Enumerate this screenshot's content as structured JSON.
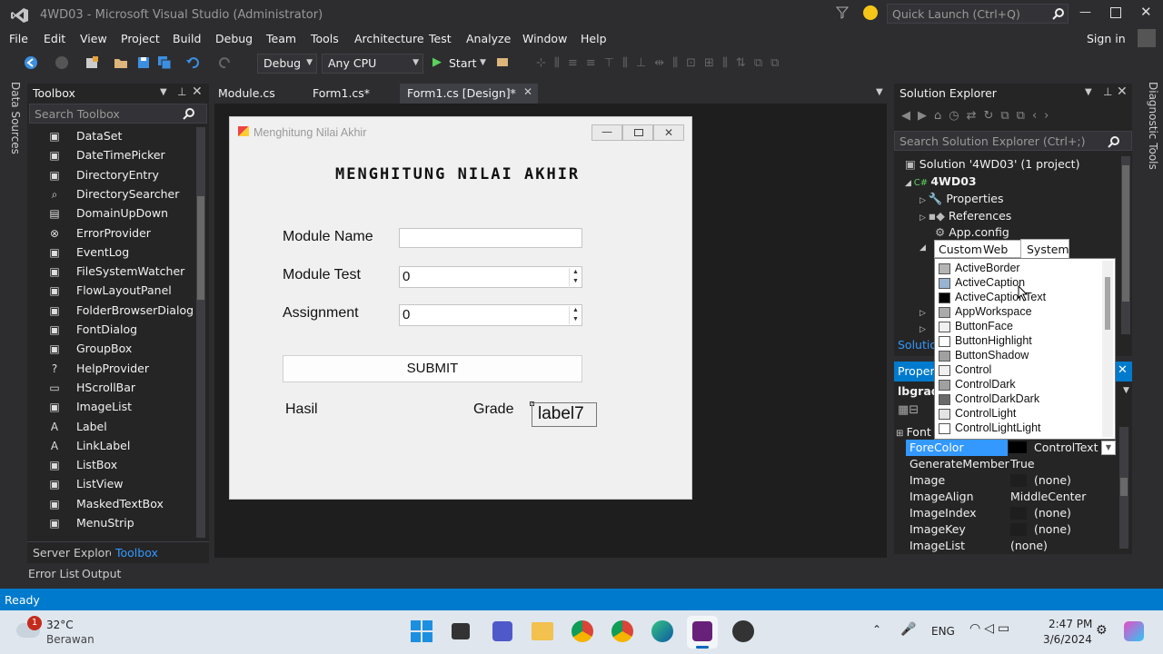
{
  "window": {
    "title": "4WD03 - Microsoft Visual Studio (Administrator)",
    "quick_launch_placeholder": "Quick Launch (Ctrl+Q)",
    "sign_in": "Sign in"
  },
  "menu": [
    "File",
    "Edit",
    "View",
    "Project",
    "Build",
    "Debug",
    "Team",
    "Tools",
    "Architecture",
    "Test",
    "Analyze",
    "Window",
    "Help"
  ],
  "toolbar": {
    "config": "Debug",
    "platform": "Any CPU",
    "start_label": "Start"
  },
  "left_strip": {
    "data_sources": "Data Sources"
  },
  "right_strip": {
    "diagnostic_tools": "Diagnostic Tools"
  },
  "toolbox": {
    "title": "Toolbox",
    "search_placeholder": "Search Toolbox",
    "items": [
      {
        "icon": "dataset-icon",
        "label": "DataSet"
      },
      {
        "icon": "datetimepicker-icon",
        "label": "DateTimePicker"
      },
      {
        "icon": "directoryentry-icon",
        "label": "DirectoryEntry"
      },
      {
        "icon": "directorysearcher-icon",
        "label": "DirectorySearcher"
      },
      {
        "icon": "domainupdown-icon",
        "label": "DomainUpDown"
      },
      {
        "icon": "errorprovider-icon",
        "label": "ErrorProvider"
      },
      {
        "icon": "eventlog-icon",
        "label": "EventLog"
      },
      {
        "icon": "filesystemwatcher-icon",
        "label": "FileSystemWatcher"
      },
      {
        "icon": "flowlayoutpanel-icon",
        "label": "FlowLayoutPanel"
      },
      {
        "icon": "folderbrowserdialog-icon",
        "label": "FolderBrowserDialog"
      },
      {
        "icon": "fontdialog-icon",
        "label": "FontDialog"
      },
      {
        "icon": "groupbox-icon",
        "label": "GroupBox"
      },
      {
        "icon": "helpprovider-icon",
        "label": "HelpProvider"
      },
      {
        "icon": "hscrollbar-icon",
        "label": "HScrollBar"
      },
      {
        "icon": "imagelist-icon",
        "label": "ImageList"
      },
      {
        "icon": "label-icon",
        "label": "Label"
      },
      {
        "icon": "linklabel-icon",
        "label": "LinkLabel"
      },
      {
        "icon": "listbox-icon",
        "label": "ListBox"
      },
      {
        "icon": "listview-icon",
        "label": "ListView"
      },
      {
        "icon": "maskedtextbox-icon",
        "label": "MaskedTextBox"
      },
      {
        "icon": "menustrip-icon",
        "label": "MenuStrip"
      }
    ],
    "bottom_tabs": [
      "Server Explorer",
      "Toolbox"
    ]
  },
  "doc_tabs": [
    "Module.cs",
    "Form1.cs*",
    "Form1.cs [Design]*"
  ],
  "form": {
    "title": "Menghitung Nilai Akhir",
    "heading": "MENGHITUNG NILAI AKHIR",
    "module_name_label": "Module Name",
    "module_name_value": "",
    "module_test_label": "Module Test",
    "module_test_value": "0",
    "assignment_label": "Assignment",
    "assignment_value": "0",
    "submit_label": "SUBMIT",
    "hasil_label": "Hasil",
    "grade_label": "Grade",
    "grade_value_label": "label7"
  },
  "solution_explorer": {
    "title": "Solution Explorer",
    "search_placeholder": "Search Solution Explorer (Ctrl+;)",
    "solution": "Solution '4WD03' (1 project)",
    "project": "4WD03",
    "properties": "Properties",
    "references": "References",
    "app_config": "App.config",
    "tab_truncated": "Solutio"
  },
  "properties": {
    "title_truncated": "Propert",
    "object_truncated": "lbgrade",
    "font_group_truncated": "Font",
    "rows": [
      {
        "name": "ForeColor",
        "value": "ControlText",
        "selected": true
      },
      {
        "name": "GenerateMember",
        "value": "True"
      },
      {
        "name": "Image",
        "value": "(none)"
      },
      {
        "name": "ImageAlign",
        "value": "MiddleCenter"
      },
      {
        "name": "ImageIndex",
        "value": "(none)"
      },
      {
        "name": "ImageKey",
        "value": "(none)"
      },
      {
        "name": "ImageList",
        "value": "(none)"
      }
    ]
  },
  "color_picker": {
    "tabs": [
      "Custom",
      "Web",
      "System"
    ],
    "active_tab": "System",
    "colors": [
      {
        "name": "ActiveBorder",
        "color": "#b4b4b4"
      },
      {
        "name": "ActiveCaption",
        "color": "#99b4d1"
      },
      {
        "name": "ActiveCaptionText",
        "color": "#000000"
      },
      {
        "name": "AppWorkspace",
        "color": "#ababab"
      },
      {
        "name": "ButtonFace",
        "color": "#f0f0f0"
      },
      {
        "name": "ButtonHighlight",
        "color": "#ffffff"
      },
      {
        "name": "ButtonShadow",
        "color": "#a0a0a0"
      },
      {
        "name": "Control",
        "color": "#f0f0f0"
      },
      {
        "name": "ControlDark",
        "color": "#a0a0a0"
      },
      {
        "name": "ControlDarkDark",
        "color": "#696969"
      },
      {
        "name": "ControlLight",
        "color": "#e3e3e3"
      },
      {
        "name": "ControlLightLight",
        "color": "#ffffff"
      }
    ]
  },
  "bottom_panel_tabs": [
    "Error List",
    "Output"
  ],
  "status": {
    "text": "Ready"
  },
  "taskbar": {
    "weather_temp": "32°C",
    "weather_desc": "Berawan",
    "weather_badge": "1",
    "lang": "ENG",
    "time": "2:47 PM",
    "date": "3/6/2024"
  },
  "colors": {
    "accent": "#007acc",
    "selection": "#3399ff"
  }
}
